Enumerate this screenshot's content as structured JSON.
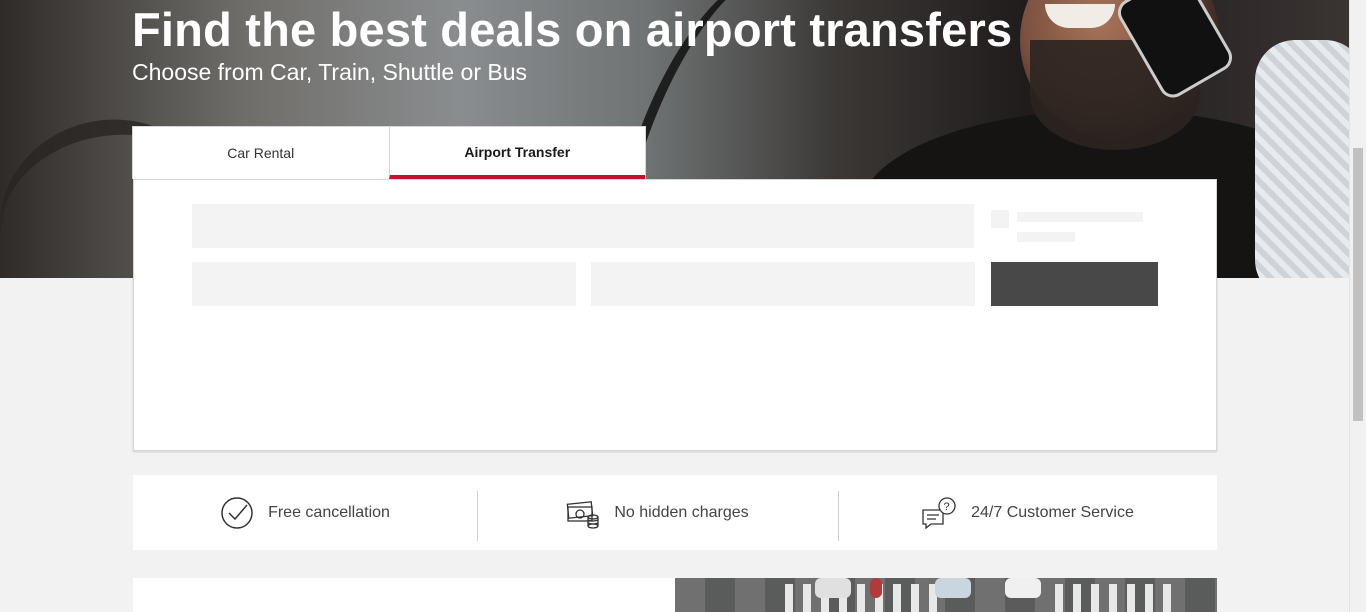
{
  "hero": {
    "title": "Find the best deals on airport transfers",
    "subtitle": "Choose from Car, Train, Shuttle or Bus"
  },
  "tabs": [
    {
      "label": "Car Rental",
      "active": false
    },
    {
      "label": "Airport Transfer",
      "active": true
    }
  ],
  "benefits": [
    {
      "icon": "checkmark-circle-icon",
      "label": "Free cancellation"
    },
    {
      "icon": "money-coins-icon",
      "label": "No hidden charges"
    },
    {
      "icon": "chat-question-icon",
      "label": "24/7 Customer Service"
    }
  ],
  "colors": {
    "accent": "#c8102e",
    "page_bg": "#f2f2f2",
    "skeleton": "#f3f3f3",
    "skeleton_button": "#484848"
  }
}
